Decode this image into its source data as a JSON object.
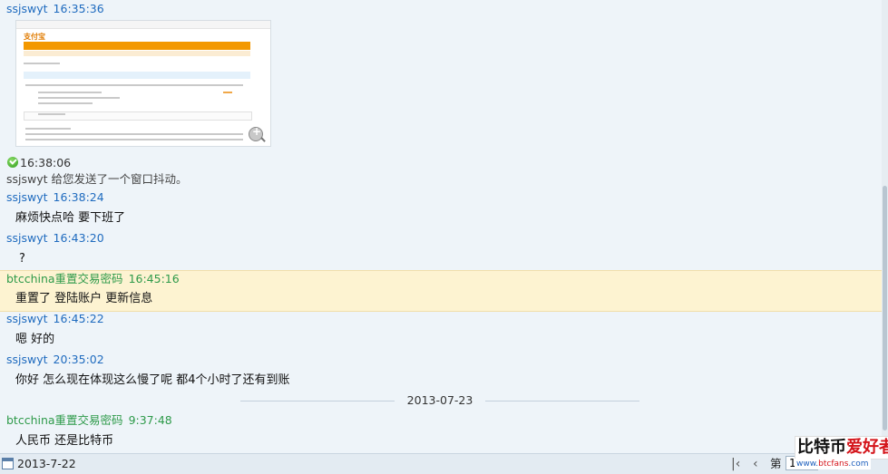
{
  "messages": [
    {
      "sender": "ssjswyt",
      "time": "16:35:36"
    },
    {
      "sender": "ssjswyt",
      "time": "16:38:24",
      "text": "麻烦快点哈 要下班了"
    },
    {
      "sender": "ssjswyt",
      "time": "16:43:20",
      "text": "?"
    },
    {
      "sender": "btcchina重置交易密码",
      "time": "16:45:16",
      "text": "重置了 登陆账户 更新信息"
    },
    {
      "sender": "ssjswyt",
      "time": "16:45:22",
      "text": "嗯 好的"
    },
    {
      "sender": "ssjswyt",
      "time": "20:35:02",
      "text": "你好  怎么现在体现这么慢了呢  都4个小时了还有到账"
    },
    {
      "sender": "btcchina重置交易密码",
      "time": "9:37:48",
      "text": "人民币 还是比特币"
    }
  ],
  "system": {
    "time": "16:38:06",
    "text": "ssjswyt 给您发送了一个窗口抖动。"
  },
  "thumbnail": {
    "logo": "支付宝"
  },
  "date_divider": "2013-07-23",
  "footer": {
    "date": "2013-7-22",
    "page_label": "第",
    "page_value": "1"
  },
  "watermark": {
    "part1": "比特币",
    "part2": "爱好者",
    "url_a": "www.",
    "url_b": "btcfans",
    "url_c": ".com"
  },
  "colors": {
    "self": "#1f6bbf",
    "agent": "#2e9a4a",
    "highlight": "#fdf3d1"
  }
}
